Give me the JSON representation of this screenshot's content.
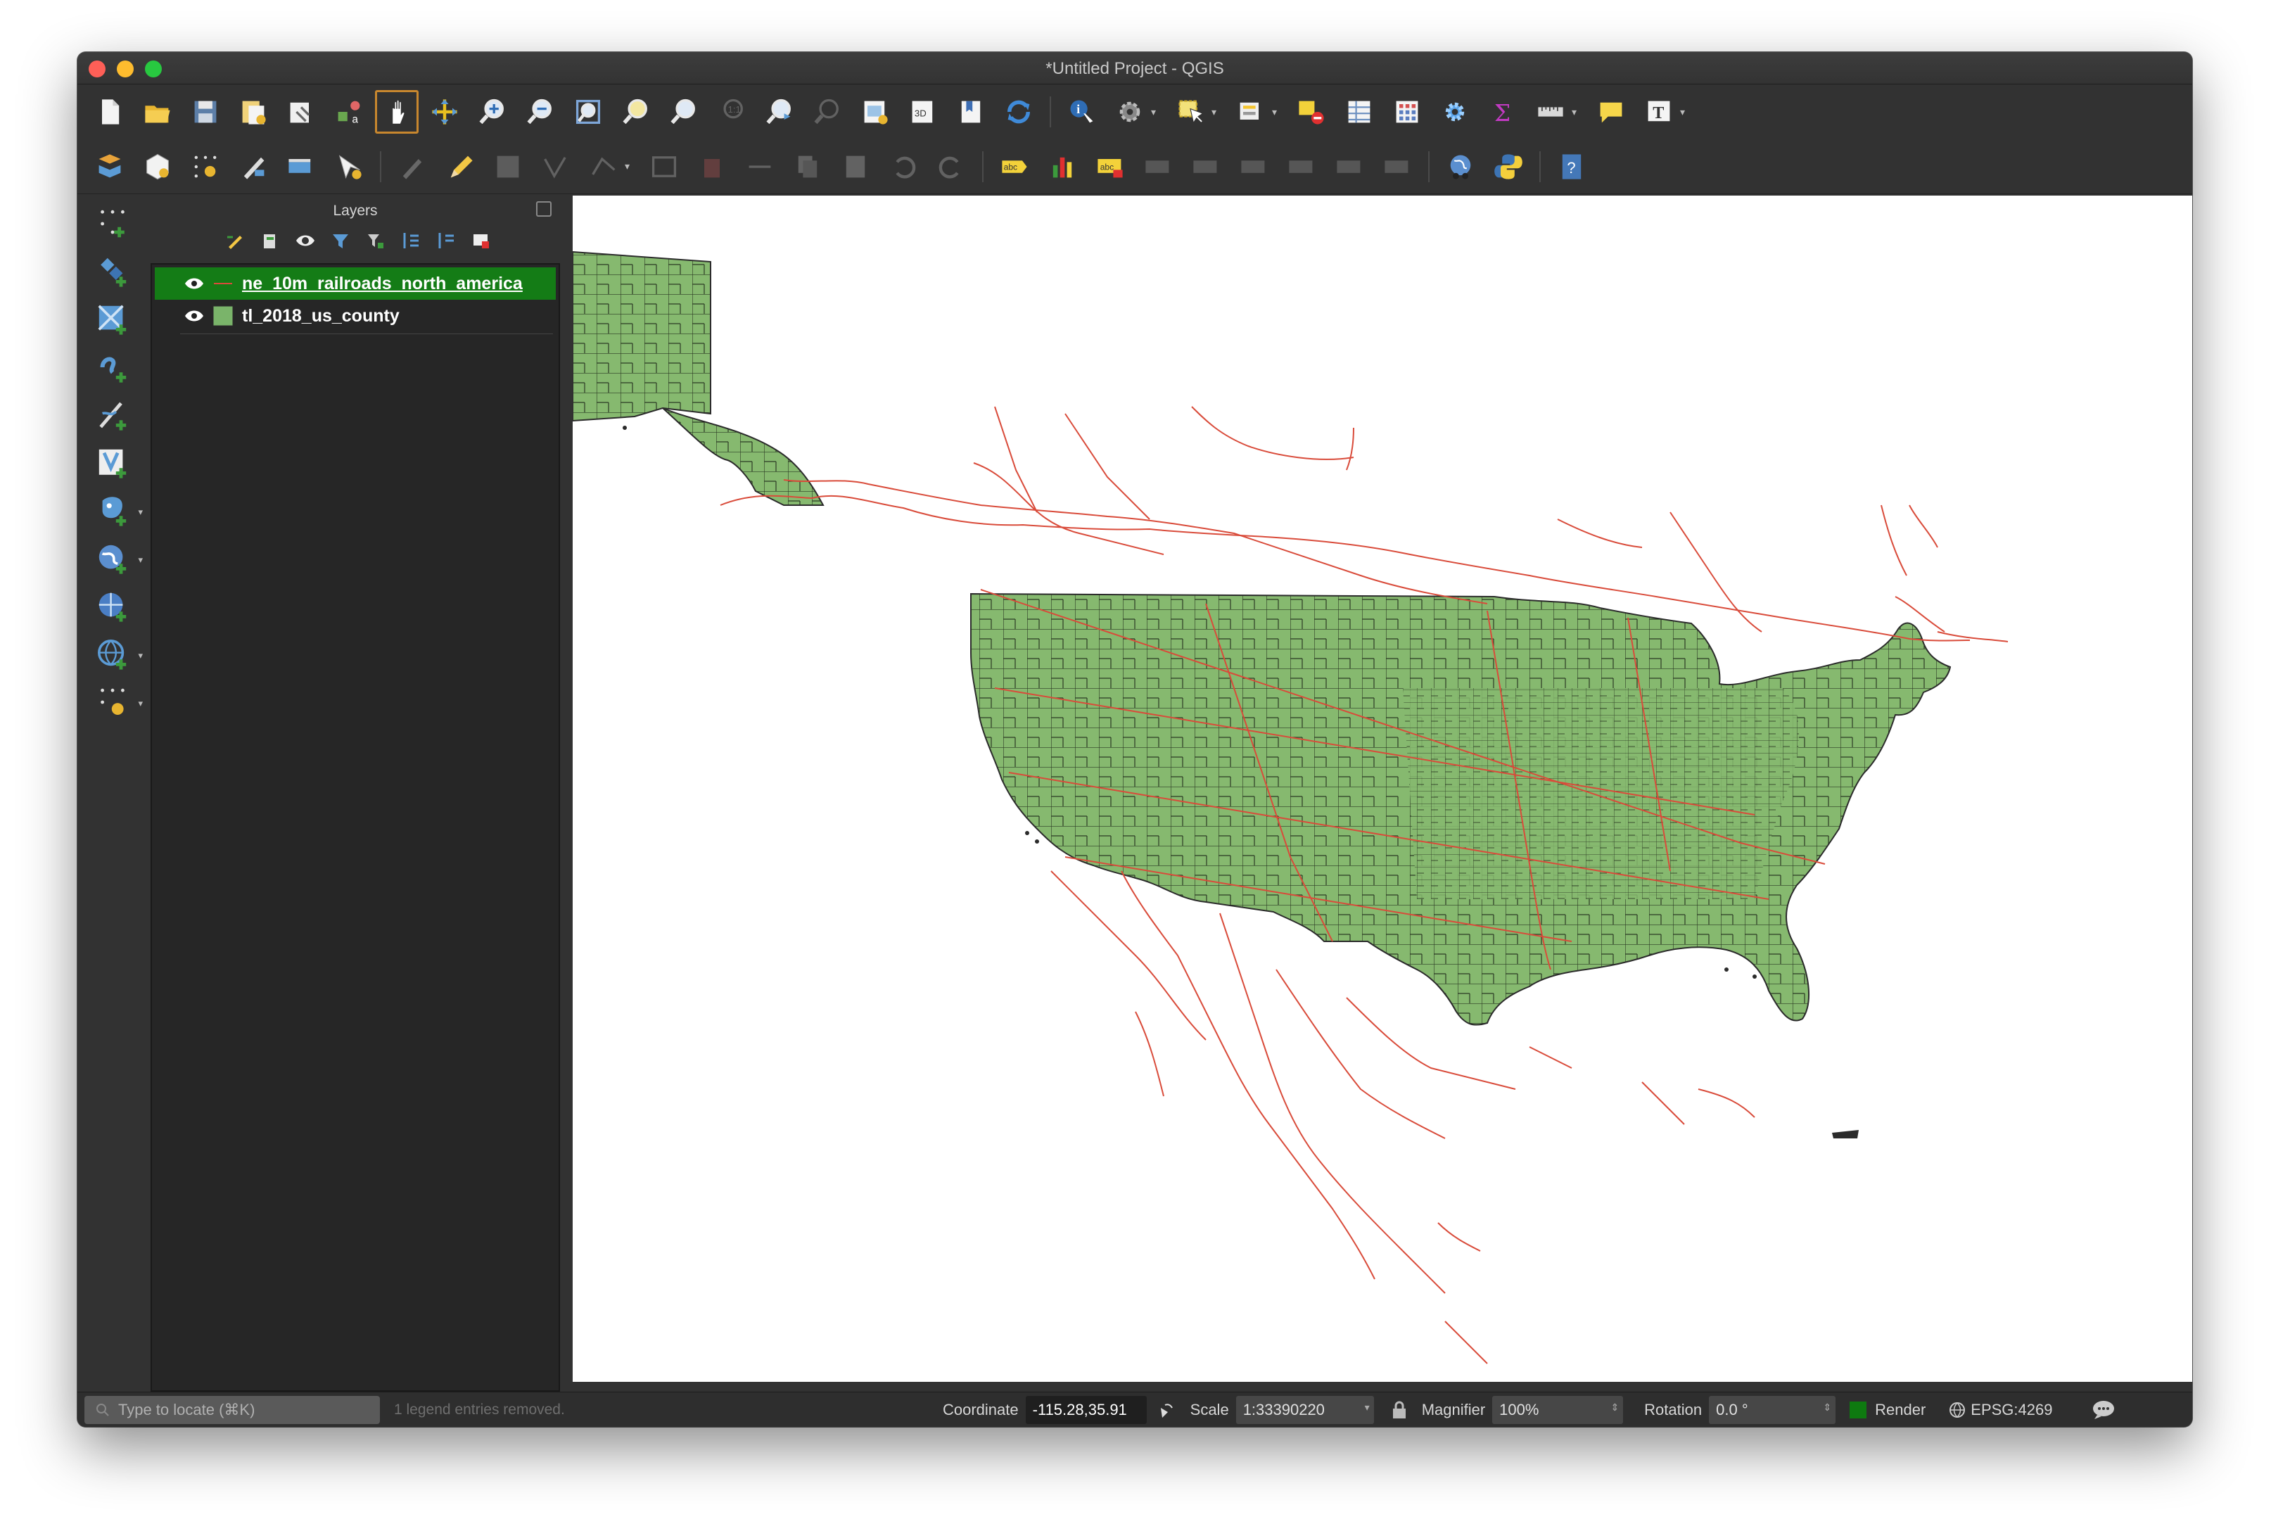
{
  "window": {
    "title": "*Untitled Project - QGIS"
  },
  "toolbar_row1": {
    "icons": [
      "new-project",
      "open-project",
      "save-project",
      "new-print-layout",
      "layout-manager",
      "style-manager",
      "pan-map",
      "pan-to-selection",
      "zoom-in",
      "zoom-out",
      "zoom-full",
      "zoom-to-selection",
      "zoom-to-layer",
      "zoom-native",
      "zoom-last",
      "zoom-next",
      "new-map-view",
      "new-3d-view",
      "new-bookmark",
      "show-bookmarks",
      "refresh",
      "identify",
      "actions",
      "select-features",
      "open-attribute-table",
      "deselect",
      "attribute-table",
      "field-calculator",
      "processing-toolbox",
      "statistics",
      "measure",
      "map-tips",
      "text-annotation"
    ]
  },
  "toolbar_row2": {
    "icons": [
      "data-source-manager",
      "new-geopackage-layer",
      "new-temporary-layer",
      "digitize",
      "new-shapefile",
      "new-spatialite",
      "current-edits",
      "toggle-editing",
      "save-edits",
      "add-feature",
      "vertex-tool",
      "modify-attributes",
      "delete-selected",
      "cut-features",
      "copy-features",
      "paste-features",
      "undo",
      "redo",
      "label-tool",
      "diagram-tool",
      "label-options",
      "pin-labels",
      "show-hide-labels",
      "move-label",
      "rotate-label",
      "change-label",
      "globe",
      "python-console",
      "help"
    ]
  },
  "left_toolbar": {
    "icons": [
      "add-delimited-text",
      "add-vector-layer",
      "add-raster-layer",
      "add-mesh-layer",
      "add-spatialite",
      "add-postgis",
      "add-wms",
      "add-wfs",
      "add-wcs",
      "add-virtual-layer"
    ]
  },
  "layers_panel": {
    "title": "Layers",
    "layers": [
      {
        "name": "ne_10m_railroads_north_america",
        "selected": true,
        "symbol_color": "#d94b3a"
      },
      {
        "name": "tl_2018_us_county",
        "selected": false,
        "symbol_color": "#7ab46a"
      }
    ]
  },
  "map": {
    "land_color": "#86b96f",
    "rail_color": "#d94b3a",
    "outline_color": "#2b2b2b"
  },
  "statusbar": {
    "locate_placeholder": "Type to locate (⌘K)",
    "message": "1 legend entries removed.",
    "coordinate_label": "Coordinate",
    "coordinate_value": "-115.28,35.91",
    "scale_label": "Scale",
    "scale_value": "1:33390220",
    "magnifier_label": "Magnifier",
    "magnifier_value": "100%",
    "rotation_label": "Rotation",
    "rotation_value": "0.0 °",
    "render_label": "Render",
    "crs": "EPSG:4269"
  }
}
